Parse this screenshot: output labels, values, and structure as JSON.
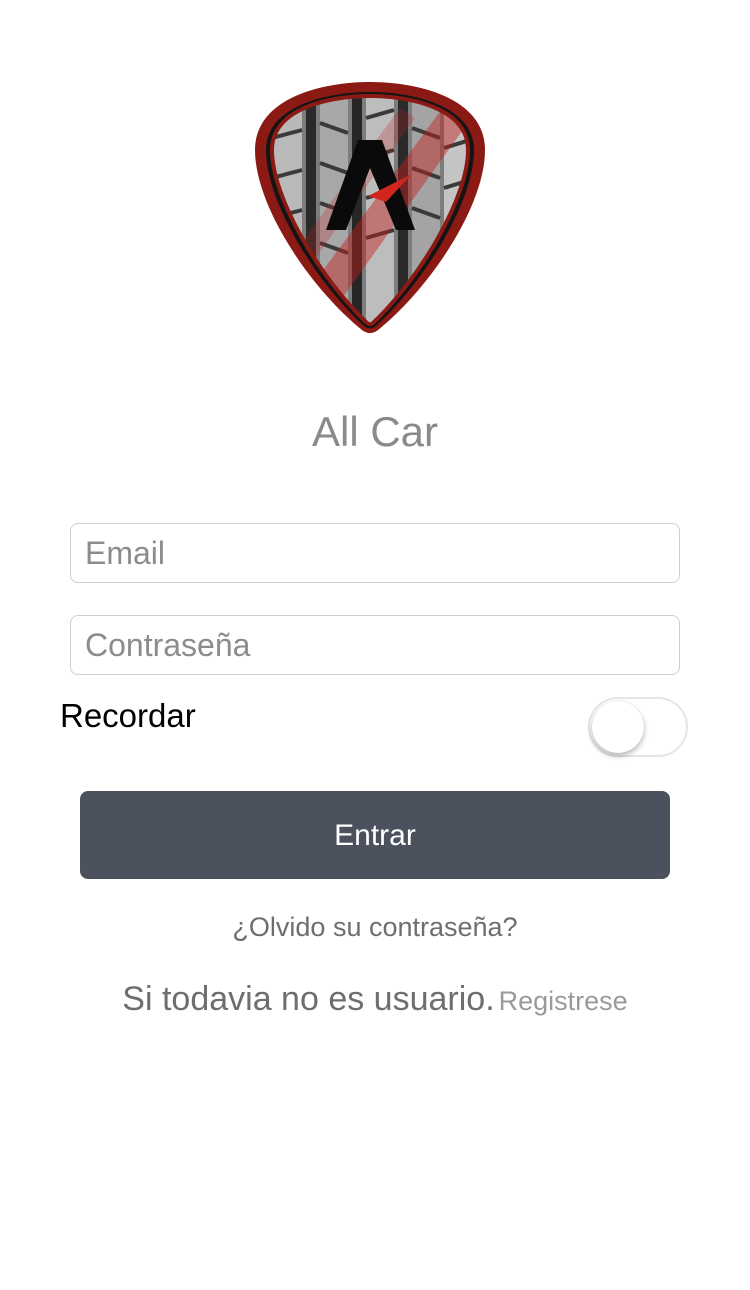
{
  "app": {
    "title": "All Car",
    "logo_icon": "shield-tire-logo-icon",
    "brand_color": "#8b1a14"
  },
  "form": {
    "email_placeholder": "Email",
    "email_value": "",
    "password_placeholder": "Contraseña",
    "password_value": "",
    "remember_label": "Recordar",
    "remember_on": false,
    "submit_label": "Entrar",
    "submit_color": "#4c525d"
  },
  "links": {
    "forgot_password": "¿Olvido su contraseña?",
    "signup_prompt": "Si todavia no es usuario.",
    "signup_link": "Registrese"
  }
}
